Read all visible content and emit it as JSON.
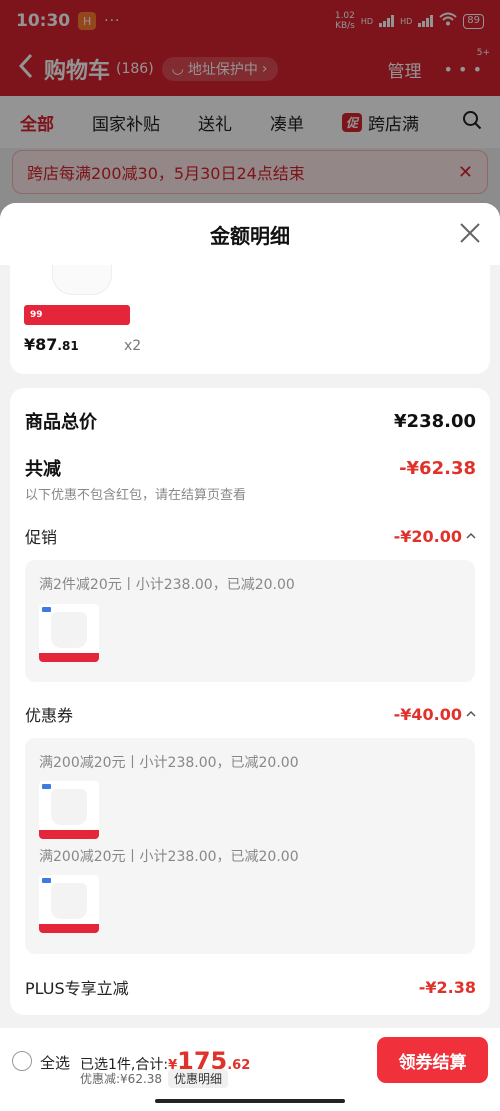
{
  "status_bar": {
    "time": "10:30",
    "app_badge": "H",
    "dots": "···",
    "net_speed": "1.02",
    "net_unit": "KB/s",
    "hd1": "HD",
    "hd2": "HD",
    "battery": "89"
  },
  "cart_header": {
    "title": "购物车",
    "count": "(186)",
    "address_protect": "地址保护中",
    "manage": "管理",
    "more_badge": "5+"
  },
  "tabs": [
    {
      "label": "全部"
    },
    {
      "label": "国家补贴"
    },
    {
      "label": "送礼"
    },
    {
      "label": "凑单"
    },
    {
      "label": "跨店满",
      "tag": "促"
    }
  ],
  "notice": {
    "text": "跨店每满200减30，5月30日24点结束"
  },
  "sheet": {
    "title": "金额明细",
    "product": {
      "ribbon_text": "99",
      "price_symbol": "¥",
      "price_int": "87",
      "price_dec": ".81",
      "qty": "x2"
    },
    "total_label": "商品总价",
    "total_value": "¥238.00",
    "reduce_label": "共减",
    "reduce_value": "-¥62.38",
    "note": "以下优惠不包含红包，请在结算页查看",
    "promo": {
      "label": "促销",
      "value": "-¥20.00",
      "line": "满2件减20元丨小计238.00，已减20.00"
    },
    "coupon": {
      "label": "优惠券",
      "value": "-¥40.00",
      "lines": [
        "满200减20元丨小计238.00，已减20.00",
        "满200减20元丨小计238.00，已减20.00"
      ]
    },
    "plus": {
      "label": "PLUS专享立减",
      "value": "-¥2.38"
    }
  },
  "bottom_bar": {
    "select_all": "全选",
    "selected_prefix": "已选1件,合计:",
    "total_symbol": "¥",
    "total_int": "175",
    "total_dec": ".62",
    "discount": "优惠减:¥62.38",
    "detail_chip": "优惠明细",
    "checkout": "领券结算"
  },
  "colors": {
    "brand_red": "#d9232f",
    "price_red": "#e0322b",
    "button_red": "#f0313b"
  }
}
